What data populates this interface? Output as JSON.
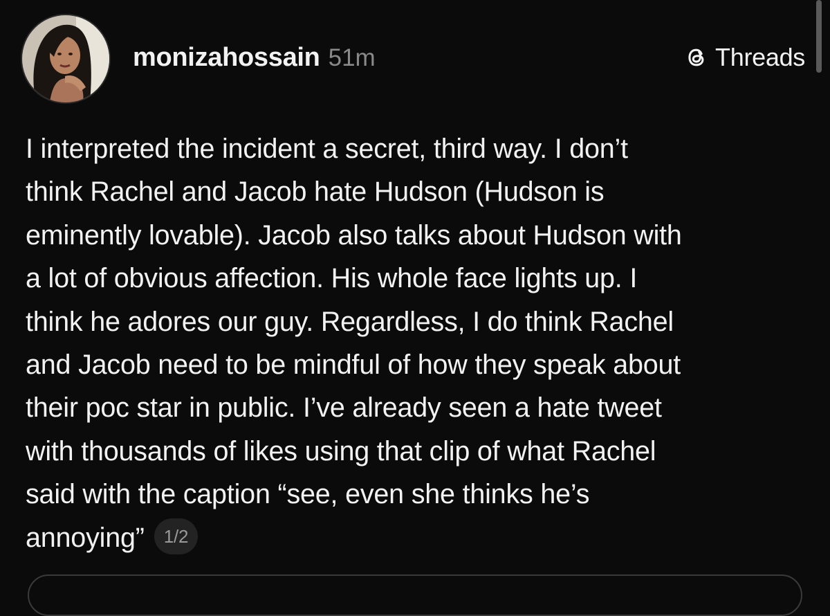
{
  "post": {
    "username": "monizahossain",
    "timestamp": "51m",
    "source_label": "Threads",
    "source_icon": "threads-logo-icon",
    "body_lines": [
      "I interpreted the incident a secret, third way.  I don’t",
      "think Rachel and Jacob hate Hudson (Hudson is",
      "eminently lovable). Jacob also talks about Hudson with",
      "a lot of obvious affection. His whole face lights up. I",
      "think he adores our guy. Regardless, I do think Rachel",
      "and Jacob need to be mindful of how they speak about",
      "their poc star in public. I’ve already seen a hate tweet",
      "with thousands of likes using that clip of what Rachel",
      "said with the caption “see, even she thinks he’s",
      "annoying”"
    ],
    "page_indicator": "1/2"
  },
  "colors": {
    "background": "#0b0b0b",
    "text": "#f2f2f2",
    "muted": "#8a8a8a"
  }
}
